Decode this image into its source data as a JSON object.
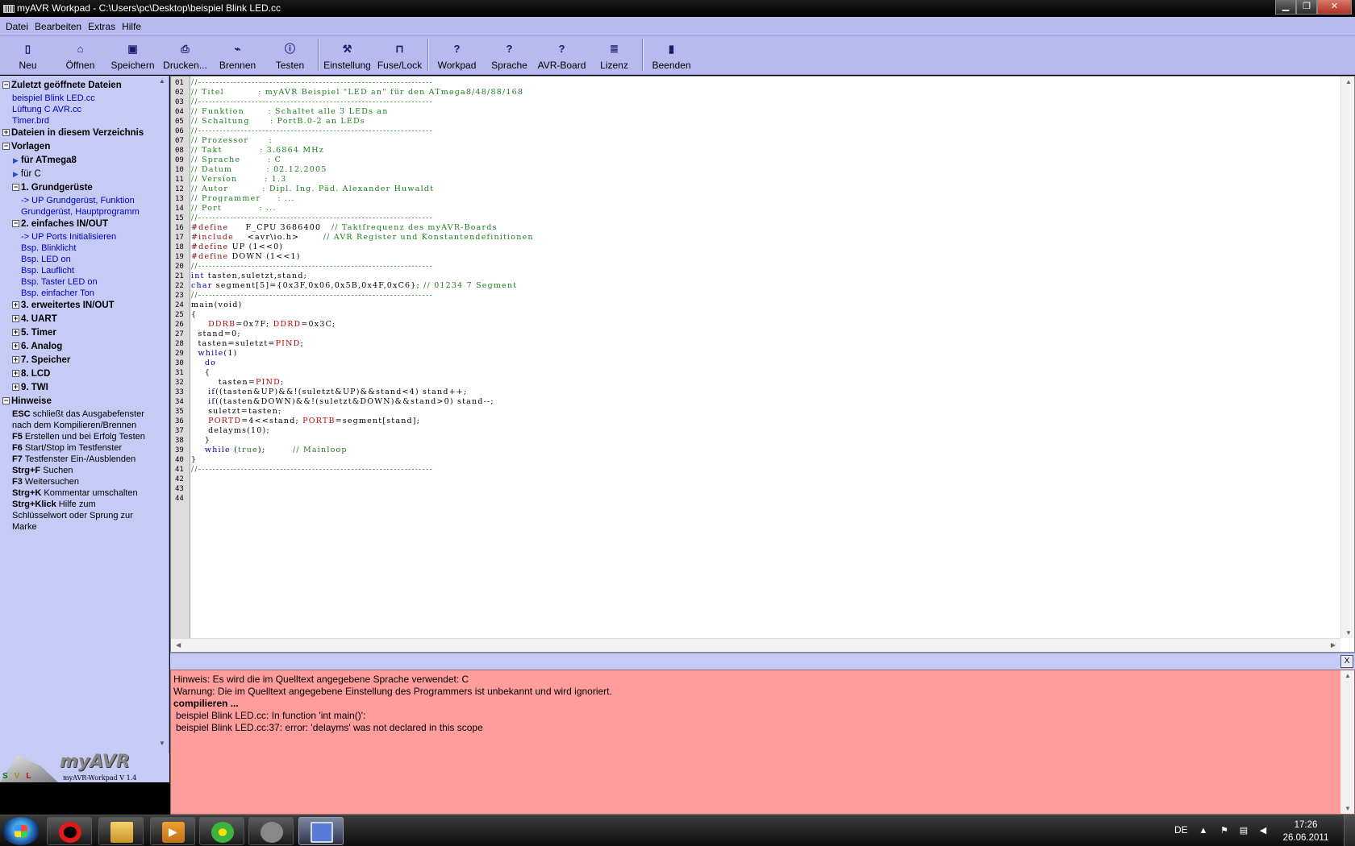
{
  "window": {
    "title": "myAVR Workpad - C:\\Users\\pc\\Desktop\\beispiel Blink LED.cc",
    "minimize": "▁",
    "maximize": "❐",
    "close": "✕"
  },
  "menu": [
    "Datei",
    "Bearbeiten",
    "Extras",
    "Hilfe"
  ],
  "toolbar": [
    {
      "label": "Neu",
      "icon": "new-file-icon",
      "glyph": "▯"
    },
    {
      "label": "Öffnen",
      "icon": "open-folder-icon",
      "glyph": "⌂"
    },
    {
      "label": "Speichern",
      "icon": "floppy-disk-icon",
      "glyph": "▣"
    },
    {
      "label": "Drucken...",
      "icon": "printer-icon",
      "glyph": "⎙"
    },
    {
      "label": "Brennen",
      "icon": "burn-chip-icon",
      "glyph": "⌁"
    },
    {
      "label": "Testen",
      "icon": "info-circle-icon",
      "glyph": "ⓘ"
    },
    {
      "label": "Einstellung",
      "icon": "wrench-icon",
      "glyph": "⚒"
    },
    {
      "label": "Fuse/Lock",
      "icon": "padlock-icon",
      "glyph": "⊓"
    },
    {
      "label": "Workpad",
      "icon": "help-question-icon",
      "glyph": "?"
    },
    {
      "label": "Sprache",
      "icon": "help-question-icon",
      "glyph": "?"
    },
    {
      "label": "AVR-Board",
      "icon": "help-question-icon",
      "glyph": "?"
    },
    {
      "label": "Lizenz",
      "icon": "certificate-icon",
      "glyph": "≣"
    },
    {
      "label": "Beenden",
      "icon": "exit-door-icon",
      "glyph": "▮"
    }
  ],
  "sidebar": {
    "recent_title": "Zuletzt geöffnete Dateien",
    "recent": [
      "beispiel Blink LED.cc",
      "Lüftung C AVR.cc",
      "Timer.brd"
    ],
    "dir_title": "Dateien in diesem Verzeichnis",
    "templates_title": "Vorlagen",
    "template_groups": [
      "für ATmega8",
      "für C"
    ],
    "basic_title": "1. Grundgerüste",
    "basic_items": [
      "-> UP Grundgerüst, Funktion",
      "Grundgerüst, Hauptprogramm"
    ],
    "io_title": "2. einfaches IN/OUT",
    "io_items": [
      "-> UP Ports Initialisieren",
      "Bsp. Blinklicht",
      "Bsp. LED on",
      "Bsp. Lauflicht",
      "Bsp. Taster LED on",
      "Bsp. einfacher Ton"
    ],
    "more_sections": [
      "3. erweitertes IN/OUT",
      "4. UART",
      "5. Timer",
      "6. Analog",
      "7. Speicher",
      "8. LCD",
      "9. TWI"
    ],
    "hints_title": "Hinweise",
    "hints": [
      {
        "key": "ESC",
        "text": " schließt das Ausgabefenster"
      },
      {
        "key": "",
        "text": "nach dem Kompilieren/Brennen"
      },
      {
        "key": "F5",
        "text": " Erstellen und bei Erfolg Testen"
      },
      {
        "key": "F6",
        "text": " Start/Stop im Testfenster"
      },
      {
        "key": "F7",
        "text": " Testfenster Ein-/Ausblenden"
      },
      {
        "key": "Strg+F",
        "text": " Suchen"
      },
      {
        "key": "F3",
        "text": " Weitersuchen"
      },
      {
        "key": "Strg+K",
        "text": " Kommentar umschalten"
      },
      {
        "key": "Strg+Klick",
        "text": " Hilfe zum"
      },
      {
        "key": "",
        "text": "Schlüsselwort oder Sprung zur"
      },
      {
        "key": "",
        "text": "Marke"
      }
    ],
    "logo_svl": [
      "S",
      "V",
      "L"
    ],
    "logo_brand": "myAVR",
    "logo_version": "myAVR-Workpad V 1.4"
  },
  "code": [
    {
      "n": "01",
      "parts": [
        [
          "cm",
          "//------------------------------------------------------------------"
        ]
      ]
    },
    {
      "n": "02",
      "parts": [
        [
          "cm",
          "// Titel          : myAVR Beispiel \"LED an\" für den ATmega8/48/88/168"
        ]
      ]
    },
    {
      "n": "03",
      "parts": [
        [
          "cm",
          "//------------------------------------------------------------------"
        ]
      ]
    },
    {
      "n": "04",
      "parts": [
        [
          "cm",
          "// Funktion       : Schaltet alle 3 LEDs an"
        ]
      ]
    },
    {
      "n": "05",
      "parts": [
        [
          "cm",
          "// Schaltung      : PortB.0-2 an LEDs"
        ]
      ]
    },
    {
      "n": "06",
      "parts": [
        [
          "cm",
          "//------------------------------------------------------------------"
        ]
      ]
    },
    {
      "n": "07",
      "parts": [
        [
          "cm",
          "// Prozessor      :"
        ]
      ]
    },
    {
      "n": "08",
      "parts": [
        [
          "cm",
          "// Takt           : 3.6864 MHz"
        ]
      ]
    },
    {
      "n": "09",
      "parts": [
        [
          "cm",
          "// Sprache        : C"
        ]
      ]
    },
    {
      "n": "10",
      "parts": [
        [
          "cm",
          "// Datum          : 02.12.2005"
        ]
      ]
    },
    {
      "n": "11",
      "parts": [
        [
          "cm",
          "// Version        : 1.3"
        ]
      ]
    },
    {
      "n": "12",
      "parts": [
        [
          "cm",
          "// Autor          : Dipl. Ing. Päd. Alexander Huwaldt"
        ]
      ]
    },
    {
      "n": "13",
      "parts": [
        [
          "cm",
          "// Programmer     : ..."
        ]
      ]
    },
    {
      "n": "14",
      "parts": [
        [
          "cm",
          "// Port           : ..."
        ]
      ]
    },
    {
      "n": "15",
      "parts": [
        [
          "cm",
          "//------------------------------------------------------------------"
        ]
      ]
    },
    {
      "n": "16",
      "parts": [
        [
          "pp",
          "#define"
        ],
        [
          "pl",
          "     F_CPU 3686400   "
        ],
        [
          "cm",
          "// Taktfrequenz des myAVR-Boards"
        ]
      ]
    },
    {
      "n": "17",
      "parts": [
        [
          "pp",
          "#include"
        ],
        [
          "pl",
          "    <avr\\io.h>       "
        ],
        [
          "cm",
          "// AVR Register und Konstantendefinitionen"
        ]
      ]
    },
    {
      "n": "18",
      "parts": [
        [
          "pp",
          "#define"
        ],
        [
          "pl",
          " UP (1<<0)"
        ]
      ]
    },
    {
      "n": "19",
      "parts": [
        [
          "pp",
          "#define"
        ],
        [
          "pl",
          " DOWN (1<<1)"
        ]
      ]
    },
    {
      "n": "20",
      "parts": [
        [
          "cm",
          "//------------------------------------------------------------------"
        ]
      ]
    },
    {
      "n": "21",
      "parts": [
        [
          "kw",
          "int"
        ],
        [
          "pl",
          " tasten,suletzt,stand;"
        ]
      ]
    },
    {
      "n": "22",
      "parts": [
        [
          "kw",
          "char"
        ],
        [
          "pl",
          " segment[5]={0x3F,0x06,0x5B,0x4F,0xC6}; "
        ],
        [
          "cm",
          "// 01234 7 Segment"
        ]
      ]
    },
    {
      "n": "23",
      "parts": [
        [
          "cm",
          "//------------------------------------------------------------------"
        ]
      ]
    },
    {
      "n": "24",
      "parts": [
        [
          "pl",
          "main(void)"
        ]
      ]
    },
    {
      "n": "25",
      "parts": [
        [
          "pl",
          "{"
        ]
      ]
    },
    {
      "n": "26",
      "parts": [
        [
          "pl",
          "     "
        ],
        [
          "rg",
          "DDRB"
        ],
        [
          "pl",
          "=0x7F; "
        ],
        [
          "rg",
          "DDRD"
        ],
        [
          "pl",
          "=0x3C;"
        ]
      ]
    },
    {
      "n": "27",
      "parts": [
        [
          "pl",
          "  stand=0;"
        ]
      ]
    },
    {
      "n": "28",
      "parts": [
        [
          "pl",
          "  tasten=suletzt="
        ],
        [
          "rg",
          "PIND"
        ],
        [
          "pl",
          ";"
        ]
      ]
    },
    {
      "n": "29",
      "parts": [
        [
          "pl",
          "  "
        ],
        [
          "kw",
          "while"
        ],
        [
          "pl",
          "(1)"
        ]
      ]
    },
    {
      "n": "30",
      "parts": [
        [
          "pl",
          "    "
        ],
        [
          "kw",
          "do"
        ]
      ]
    },
    {
      "n": "31",
      "parts": [
        [
          "pl",
          "    {"
        ]
      ]
    },
    {
      "n": "32",
      "parts": [
        [
          "pl",
          "        tasten="
        ],
        [
          "rg",
          "PIND"
        ],
        [
          "pl",
          ";"
        ]
      ]
    },
    {
      "n": "33",
      "parts": [
        [
          "pl",
          "     "
        ],
        [
          "kw",
          "if"
        ],
        [
          "pl",
          "((tasten&UP)&&!(suletzt&UP)&&stand<4) stand++;"
        ]
      ]
    },
    {
      "n": "34",
      "parts": [
        [
          "pl",
          "     "
        ],
        [
          "kw",
          "if"
        ],
        [
          "pl",
          "((tasten&DOWN)&&!(suletzt&DOWN)&&stand>0) stand--;"
        ]
      ]
    },
    {
      "n": "35",
      "parts": [
        [
          "pl",
          "     suletzt=tasten;"
        ]
      ]
    },
    {
      "n": "36",
      "parts": [
        [
          "pl",
          "     "
        ],
        [
          "rg",
          "PORTD"
        ],
        [
          "pl",
          "=4<<stand; "
        ],
        [
          "rg",
          "PORTB"
        ],
        [
          "pl",
          "=segment[stand];"
        ]
      ]
    },
    {
      "n": "37",
      "parts": [
        [
          "pl",
          "     delayms(10);"
        ]
      ]
    },
    {
      "n": "38",
      "parts": [
        [
          "pl",
          "    }"
        ]
      ]
    },
    {
      "n": "39",
      "parts": [
        [
          "pl",
          "    "
        ],
        [
          "kw",
          "while"
        ],
        [
          "pl",
          " ("
        ],
        [
          "tr",
          "true"
        ],
        [
          "pl",
          ");        "
        ],
        [
          "cm",
          "// Mainloop"
        ]
      ]
    },
    {
      "n": "40",
      "parts": [
        [
          "pl",
          "}"
        ]
      ]
    },
    {
      "n": "41",
      "parts": [
        [
          "cm",
          "//------------------------------------------------------------------"
        ]
      ]
    },
    {
      "n": "42",
      "parts": []
    },
    {
      "n": "43",
      "parts": []
    },
    {
      "n": "44",
      "parts": []
    }
  ],
  "output": {
    "close": "X",
    "lines": [
      {
        "text": "Hinweis: Es wird die im Quelltext angegebene Sprache verwendet: C",
        "style": ""
      },
      {
        "text": "Warnung: Die im Quelltext angegebene Einstellung des Programmers ist unbekannt und wird ignoriert.",
        "style": ""
      },
      {
        "text": "compilieren ...",
        "style": "bold"
      },
      {
        "text": "beispiel Blink LED.cc: In function 'int main()':",
        "style": "ind"
      },
      {
        "text": "beispiel Blink LED.cc:37: error: 'delayms' was not declared in this scope",
        "style": "ind"
      }
    ]
  },
  "taskbar": {
    "apps": [
      {
        "name": "opera-app",
        "glyph": "g-opera"
      },
      {
        "name": "explorer-app",
        "glyph": "g-folder"
      },
      {
        "name": "media-player-app",
        "glyph": "g-media"
      },
      {
        "name": "icq-app",
        "glyph": "g-icq"
      },
      {
        "name": "tool-app",
        "glyph": "g-tool"
      },
      {
        "name": "myavr-workpad-app",
        "glyph": "g-avr"
      }
    ],
    "lang": "DE",
    "time": "17:26",
    "date": "26.06.2011"
  }
}
